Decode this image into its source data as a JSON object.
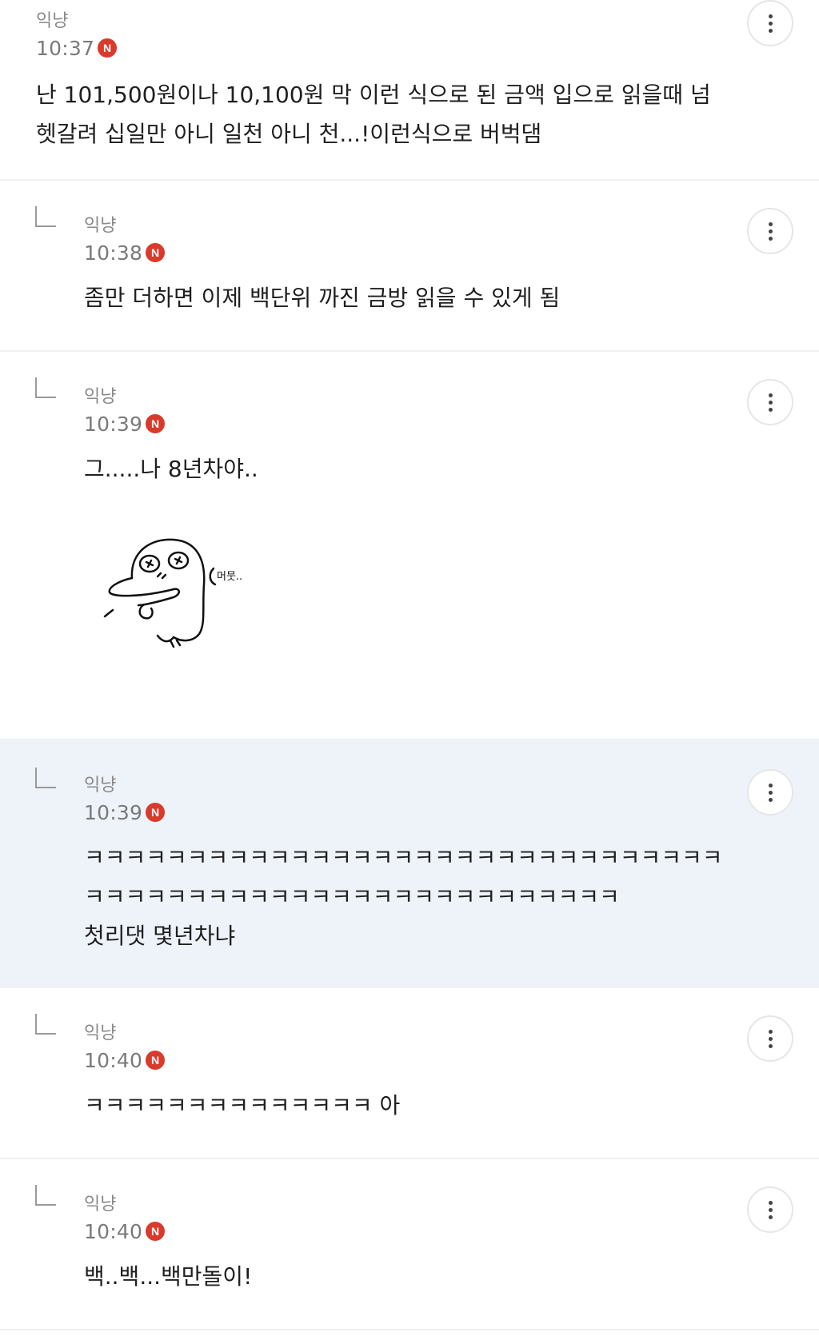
{
  "comments": [
    {
      "author": "익냥",
      "time": "10:37",
      "badge": "N",
      "text": "난 101,500원이나 10,100원 막 이런 식으로 된 금액 입으로 읽을때 넘\n헷갈려 십일만 아니 일천 아니 천...!이런식으로 버벅댐"
    },
    {
      "author": "익냥",
      "time": "10:38",
      "badge": "N",
      "text": "좀만 더하면 이제 백단위 까진 금방 읽을 수 있게 됨"
    },
    {
      "author": "익냥",
      "time": "10:39",
      "badge": "N",
      "text": "그.....나 8년차야..",
      "sticker_text": "머뭇.."
    },
    {
      "author": "익냥",
      "time": "10:39",
      "badge": "N",
      "text": "ㅋㅋㅋㅋㅋㅋㅋㅋㅋㅋㅋㅋㅋㅋㅋㅋㅋㅋㅋㅋㅋㅋㅋㅋㅋㅋㅋㅋㅋㅋㅋ\nㅋㅋㅋㅋㅋㅋㅋㅋㅋㅋㅋㅋㅋㅋㅋㅋㅋㅋㅋㅋㅋㅋㅋㅋㅋㅋ\n첫리댓 몇년차냐"
    },
    {
      "author": "익냥",
      "time": "10:40",
      "badge": "N",
      "text": "ㅋㅋㅋㅋㅋㅋㅋㅋㅋㅋㅋㅋㅋㅋ 아"
    },
    {
      "author": "익냥",
      "time": "10:40",
      "badge": "N",
      "text": "백..백...백만돌이!"
    }
  ],
  "colors": {
    "badge": "#d93a2b",
    "highlight_bg": "#eef3fa",
    "divider": "#f0f1f3"
  },
  "icons": {
    "more": "more-vertical-icon",
    "reply": "reply-arrow-icon"
  }
}
